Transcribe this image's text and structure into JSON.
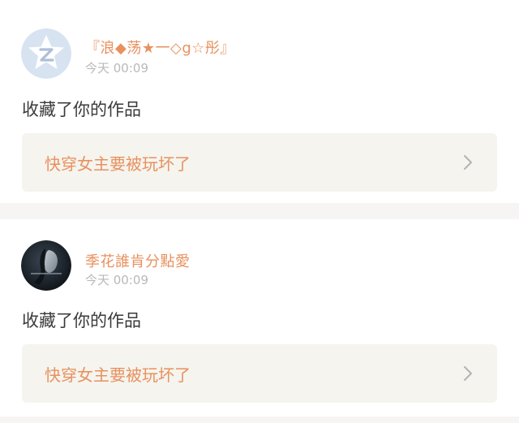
{
  "notifications": [
    {
      "username": "『浪◆荡★一◇g☆彤』",
      "time": "今天 00:09",
      "action": "收藏了你的作品",
      "work_title": "快穿女主要被玩坏了",
      "avatar_icon": "default-star-avatar-icon"
    },
    {
      "username": "季花誰肯分點愛",
      "time": "今天 00:09",
      "action": "收藏了你的作品",
      "work_title": "快穿女主要被玩坏了",
      "avatar_icon": "photo-avatar"
    }
  ],
  "colors": {
    "accent": "#e8915f",
    "tab_indicator": "#e76aa0",
    "box_bg": "#f5f4ee",
    "divider": "#f6f5f4"
  }
}
